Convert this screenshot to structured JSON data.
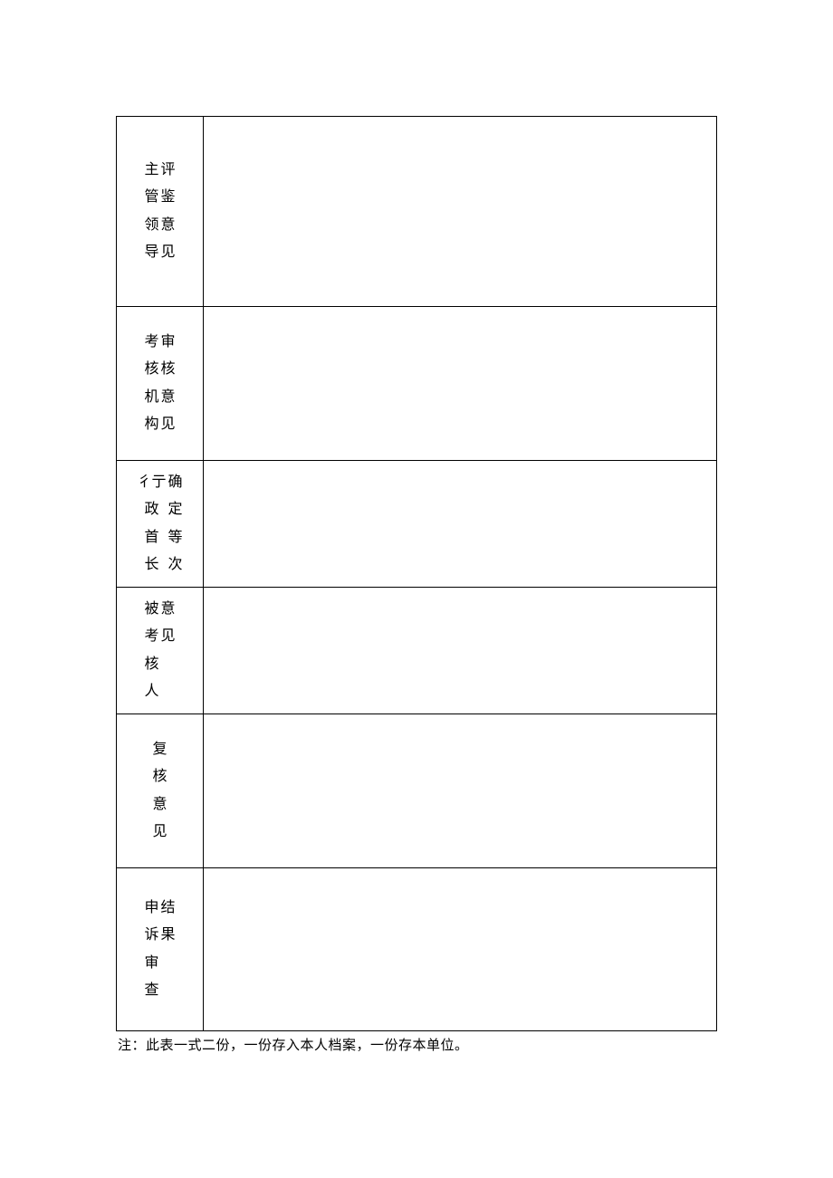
{
  "rows": [
    {
      "col1": [
        "主",
        "管",
        "领",
        "导"
      ],
      "col2": [
        "评",
        "鉴",
        "意",
        "见"
      ]
    },
    {
      "col1": [
        "考",
        "核",
        "机",
        "构"
      ],
      "col2": [
        "审",
        "核",
        "意",
        "见"
      ]
    },
    {
      "col1": [
        "彳亍",
        "政",
        "首",
        "长"
      ],
      "col2": [
        "确",
        "定",
        "等",
        "次"
      ]
    },
    {
      "col1": [
        "被",
        "考",
        "核",
        "人"
      ],
      "col2": [
        "意",
        "",
        "",
        "见"
      ]
    },
    {
      "single": [
        "复",
        "核",
        "意",
        "见"
      ]
    },
    {
      "col1": [
        "申",
        "诉",
        "审",
        "查"
      ],
      "col2": [
        "结",
        "",
        "",
        "果"
      ]
    }
  ],
  "note": "注：此表一式二份，一份存入本人档案，一份存本单位。"
}
